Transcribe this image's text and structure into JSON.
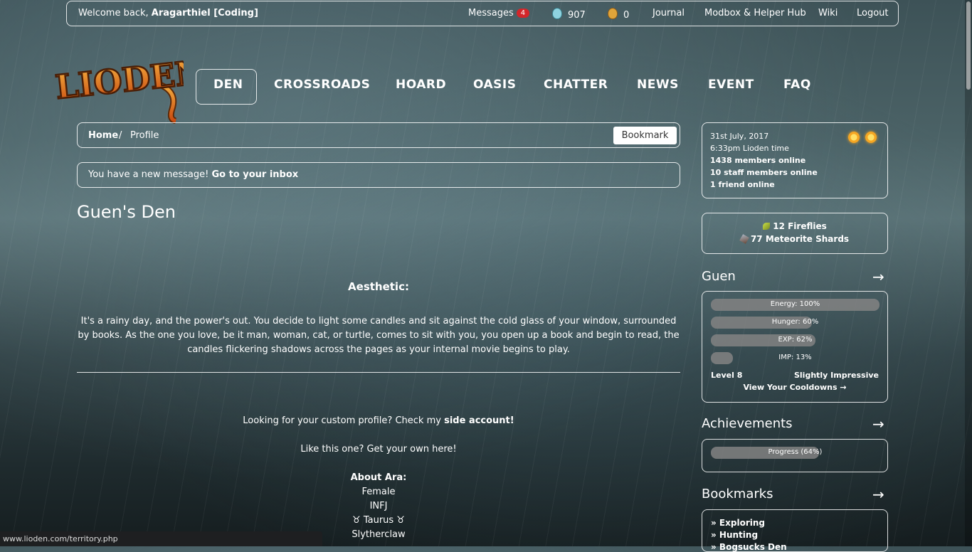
{
  "topbar": {
    "welcome_prefix": "Welcome back,",
    "username": "Aragarthiel [Coding]",
    "messages_label": "Messages",
    "messages_count": "4",
    "blue_currency": "907",
    "gold_currency": "0",
    "journal": "Journal",
    "modbox": "Modbox & Helper Hub",
    "wiki": "Wiki",
    "logout": "Logout"
  },
  "logo": {
    "text": "LIODEN"
  },
  "nav": {
    "den": "DEN",
    "crossroads": "CROSSROADS",
    "hoard": "HOARD",
    "oasis": "OASIS",
    "chatter": "CHATTER",
    "news": "NEWS",
    "event": "EVENT",
    "faq": "FAQ"
  },
  "breadcrumb": {
    "home": "Home",
    "sep": "/",
    "current": "Profile",
    "bookmark_button": "Bookmark"
  },
  "notice": {
    "text": "You have a new message!",
    "link": "Go to your inbox"
  },
  "profile": {
    "title": "Guen's Den",
    "aesthetic_heading": "Aesthetic:",
    "aesthetic_text": "It's a rainy day, and the power's out. You decide to light some candles and sit against the cold glass of your window, surrounded by books. As the one you love, be it man, woman, cat, or turtle, comes to sit with you, you open up a book and begin to read, the candles flickering shadows across the pages as your internal movie begins to play.",
    "custom_prefix": "Looking for your custom profile? Check my",
    "custom_link": "side account!",
    "like_this": "Like this one? Get your own here!",
    "about_heading": "About Ara:",
    "gender": "Female",
    "mbti": "INFJ",
    "sign": "♉ Taurus ♉",
    "house": "Slytherclaw"
  },
  "info": {
    "date": "31st July, 2017",
    "time": "6:33pm Lioden time",
    "members_online": "1438 members online",
    "staff_online": "10 staff members online",
    "friends_online": "1 friend online"
  },
  "currency": {
    "fireflies": "12 Fireflies",
    "shards": "77 Meteorite Shards"
  },
  "lion": {
    "name": "Guen",
    "arrow": "→",
    "energy_label": "Energy: 100%",
    "energy": 100,
    "hunger_label": "Hunger: 60%",
    "hunger": 60,
    "exp_label": "EXP: 62%",
    "exp": 62,
    "imp_label": "IMP: 13%",
    "imp": 13,
    "level": "Level 8",
    "imp_rank": "Slightly Impressive",
    "cooldowns": "View Your Cooldowns →"
  },
  "achievements": {
    "title": "Achievements",
    "arrow": "→",
    "progress_label": "Progress (64%)",
    "progress": 64
  },
  "bookmarks": {
    "title": "Bookmarks",
    "arrow": "→",
    "items": [
      "» Exploring",
      "» Hunting",
      "» Bogsucks Den"
    ]
  },
  "statusbar": {
    "url": "www.lioden.com/territory.php"
  },
  "colors": {
    "badge": "#d3262a",
    "logo_orange": "#e8731e",
    "logo_gold": "#f5b040"
  }
}
